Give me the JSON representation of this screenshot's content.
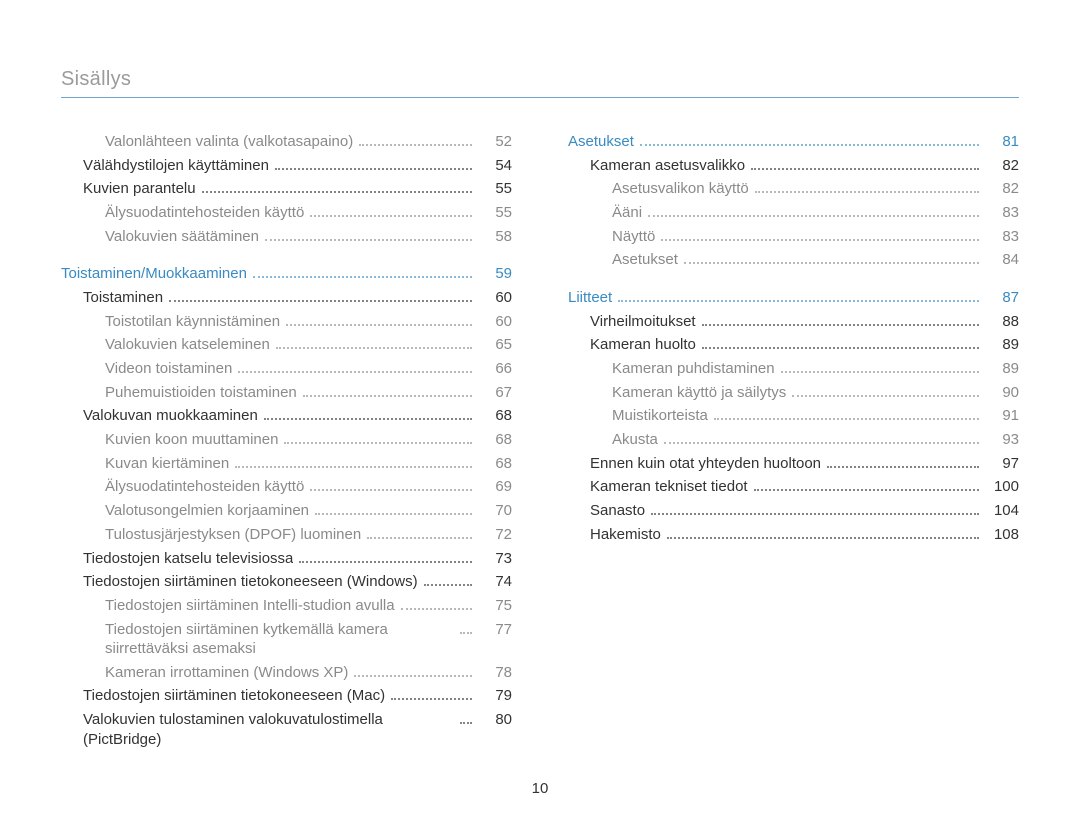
{
  "header": {
    "title": "Sisällys"
  },
  "page_number": "10",
  "columns": {
    "left": [
      {
        "level": 2,
        "label": "Valonlähteen valinta (valkotasapaino)",
        "page": "52"
      },
      {
        "level": 1,
        "label": "Välähdystilojen käyttäminen",
        "page": "54"
      },
      {
        "level": 1,
        "label": "Kuvien parantelu",
        "page": "55"
      },
      {
        "level": 2,
        "label": "Älysuodatintehosteiden käyttö",
        "page": "55"
      },
      {
        "level": 2,
        "label": "Valokuvien säätäminen",
        "page": "58"
      },
      {
        "level": 0,
        "label": "Toistaminen/Muokkaaminen",
        "page": "59",
        "gap": true
      },
      {
        "level": 1,
        "label": "Toistaminen",
        "page": "60"
      },
      {
        "level": 2,
        "label": "Toistotilan käynnistäminen",
        "page": "60"
      },
      {
        "level": 2,
        "label": "Valokuvien katseleminen",
        "page": "65"
      },
      {
        "level": 2,
        "label": "Videon toistaminen",
        "page": "66"
      },
      {
        "level": 2,
        "label": "Puhemuistioiden toistaminen",
        "page": "67"
      },
      {
        "level": 1,
        "label": "Valokuvan muokkaaminen",
        "page": "68"
      },
      {
        "level": 2,
        "label": "Kuvien koon muuttaminen",
        "page": "68"
      },
      {
        "level": 2,
        "label": "Kuvan kiertäminen",
        "page": "68"
      },
      {
        "level": 2,
        "label": "Älysuodatintehosteiden käyttö",
        "page": "69"
      },
      {
        "level": 2,
        "label": "Valotusongelmien korjaaminen",
        "page": "70"
      },
      {
        "level": 2,
        "label": "Tulostusjärjestyksen (DPOF) luominen",
        "page": "72"
      },
      {
        "level": 1,
        "label": "Tiedostojen katselu televisiossa",
        "page": "73"
      },
      {
        "level": 1,
        "label": "Tiedostojen siirtäminen tietokoneeseen (Windows)",
        "page": "74"
      },
      {
        "level": 2,
        "label": "Tiedostojen siirtäminen Intelli-studion avulla",
        "page": "75"
      },
      {
        "level": 2,
        "label": "Tiedostojen siirtäminen kytkemällä kamera siirrettäväksi asemaksi",
        "page": "77"
      },
      {
        "level": 2,
        "label": "Kameran irrottaminen (Windows XP)",
        "page": "78"
      },
      {
        "level": 1,
        "label": "Tiedostojen siirtäminen tietokoneeseen (Mac)",
        "page": "79"
      },
      {
        "level": 1,
        "label": "Valokuvien tulostaminen valokuvatulostimella (PictBridge)",
        "page": "80"
      }
    ],
    "right": [
      {
        "level": 0,
        "label": "Asetukset",
        "page": "81"
      },
      {
        "level": 1,
        "label": "Kameran asetusvalikko",
        "page": "82"
      },
      {
        "level": 2,
        "label": "Asetusvalikon käyttö",
        "page": "82"
      },
      {
        "level": 2,
        "label": "Ääni",
        "page": "83"
      },
      {
        "level": 2,
        "label": "Näyttö",
        "page": "83"
      },
      {
        "level": 2,
        "label": "Asetukset",
        "page": "84"
      },
      {
        "level": 0,
        "label": "Liitteet",
        "page": "87",
        "gap": true
      },
      {
        "level": 1,
        "label": "Virheilmoitukset",
        "page": "88"
      },
      {
        "level": 1,
        "label": "Kameran huolto",
        "page": "89"
      },
      {
        "level": 2,
        "label": "Kameran puhdistaminen",
        "page": "89"
      },
      {
        "level": 2,
        "label": "Kameran käyttö ja säilytys",
        "page": "90"
      },
      {
        "level": 2,
        "label": "Muistikorteista",
        "page": "91"
      },
      {
        "level": 2,
        "label": "Akusta",
        "page": "93"
      },
      {
        "level": 1,
        "label": "Ennen kuin otat yhteyden huoltoon",
        "page": "97"
      },
      {
        "level": 1,
        "label": "Kameran tekniset tiedot",
        "page": "100"
      },
      {
        "level": 1,
        "label": "Sanasto",
        "page": "104"
      },
      {
        "level": 1,
        "label": "Hakemisto",
        "page": "108"
      }
    ]
  }
}
